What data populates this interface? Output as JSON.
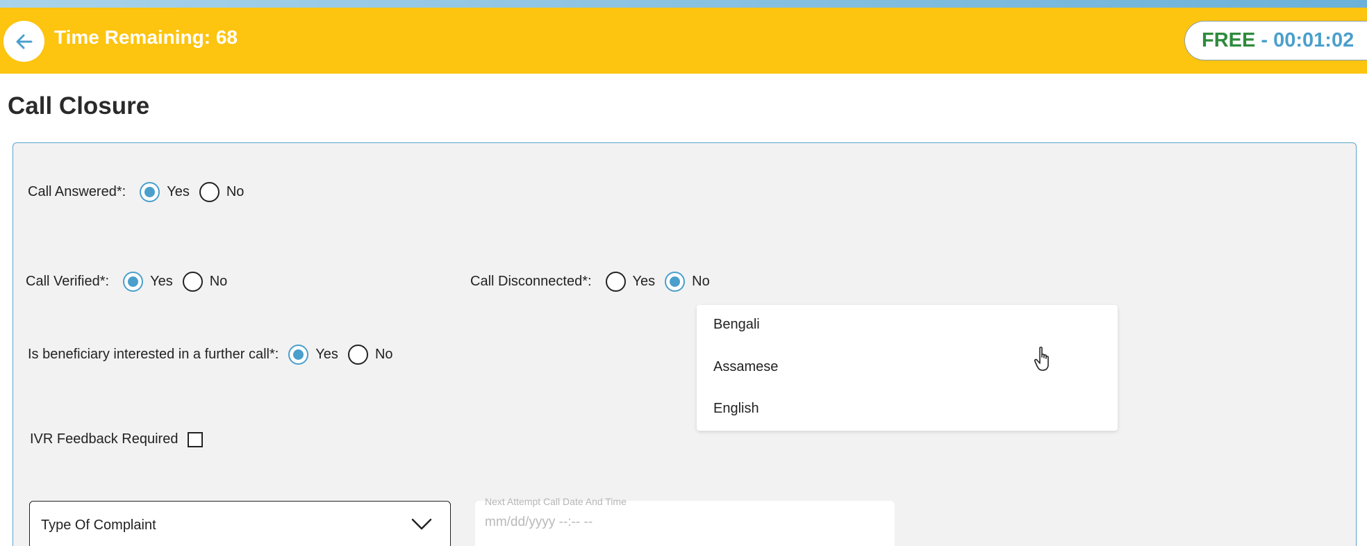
{
  "header": {
    "title": "Time Remaining: 68",
    "status": {
      "state": "FREE",
      "separator": " - ",
      "timer": "00:01:02"
    }
  },
  "page": {
    "title": "Call Closure"
  },
  "form": {
    "call_answered": {
      "label": "Call Answered*:",
      "options": [
        "Yes",
        "No"
      ],
      "selected": "Yes"
    },
    "call_verified": {
      "label": "Call Verified*:",
      "options": [
        "Yes",
        "No"
      ],
      "selected": "Yes"
    },
    "call_disconnected": {
      "label": "Call Disconnected*:",
      "options": [
        "Yes",
        "No"
      ],
      "selected": "No"
    },
    "further_call": {
      "label": "Is beneficiary interested in a further call*:",
      "options": [
        "Yes",
        "No"
      ],
      "selected": "Yes"
    },
    "ivr_feedback": {
      "label": "IVR Feedback Required",
      "checked": false
    },
    "complaint_type": {
      "placeholder": "Type Of Complaint"
    },
    "next_attempt": {
      "label": "Next Attempt Call Date And Time",
      "placeholder": "mm/dd/yyyy --:-- --"
    }
  },
  "language_dropdown": {
    "options": [
      "Bengali",
      "Assamese",
      "English"
    ]
  },
  "colors": {
    "header_bg": "#fdc410",
    "accent": "#4a9fcc",
    "free_green": "#2e8b3d",
    "panel_bg": "#f2f2f2"
  },
  "icons": [
    "back-arrow-icon",
    "chevron-down-icon",
    "hand-pointer-cursor-icon"
  ]
}
